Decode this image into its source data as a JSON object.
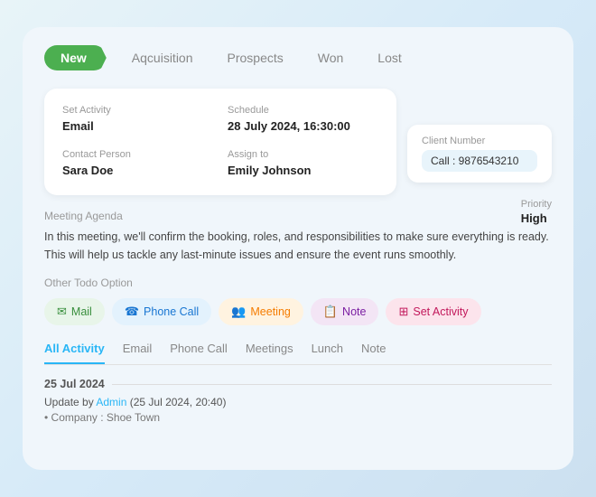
{
  "pipeline": {
    "tabs": [
      {
        "id": "new",
        "label": "New",
        "active": true
      },
      {
        "id": "acquisition",
        "label": "Aqcuisition",
        "active": false
      },
      {
        "id": "prospects",
        "label": "Prospects",
        "active": false
      },
      {
        "id": "won",
        "label": "Won",
        "active": false
      },
      {
        "id": "lost",
        "label": "Lost",
        "active": false
      }
    ]
  },
  "info_card": {
    "set_activity_label": "Set Activity",
    "set_activity_value": "Email",
    "schedule_label": "Schedule",
    "schedule_value": "28 July 2024, 16:30:00",
    "schedule_partial": "30:00",
    "contact_label": "Contact Person",
    "contact_value": "Sara Doe",
    "assign_label": "Assign to",
    "assign_value": "Emily Johnson"
  },
  "client_card": {
    "label": "Client Number",
    "value": "Call : 9876543210"
  },
  "priority": {
    "label": "Priority",
    "value": "High"
  },
  "agenda": {
    "title": "Meeting Agenda",
    "text": "In this meeting, we'll confirm the booking, roles, and responsibilities to make sure everything is ready. This will help us tackle any last-minute issues and ensure the event runs smoothly."
  },
  "todo": {
    "label": "Other Todo Option",
    "buttons": [
      {
        "id": "mail",
        "label": "Mail",
        "icon": "✉",
        "class": "btn-mail"
      },
      {
        "id": "phone",
        "label": "Phone Call",
        "icon": "☎",
        "class": "btn-phone"
      },
      {
        "id": "meeting",
        "label": "Meeting",
        "icon": "👥",
        "class": "btn-meeting"
      },
      {
        "id": "note",
        "label": "Note",
        "icon": "📋",
        "class": "btn-note"
      },
      {
        "id": "setactivity",
        "label": "Set Activity",
        "icon": "⊞",
        "class": "btn-setactivity"
      }
    ]
  },
  "activity_tabs": {
    "tabs": [
      {
        "id": "all",
        "label": "All Activity",
        "active": true
      },
      {
        "id": "email",
        "label": "Email",
        "active": false
      },
      {
        "id": "phone",
        "label": "Phone Call",
        "active": false
      },
      {
        "id": "meetings",
        "label": "Meetings",
        "active": false
      },
      {
        "id": "lunch",
        "label": "Lunch",
        "active": false
      },
      {
        "id": "note",
        "label": "Note",
        "active": false
      }
    ]
  },
  "activity_log": {
    "date": "25 Jul 2024",
    "entry": "Update by",
    "admin": "Admin",
    "entry_time": "(25 Jul 2024, 20:40)",
    "sub": "• Company : Shoe Town"
  }
}
